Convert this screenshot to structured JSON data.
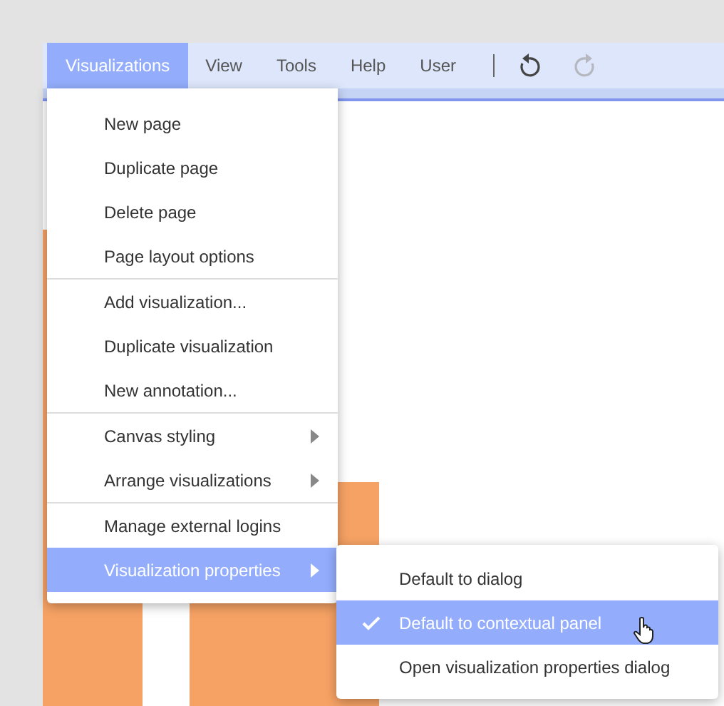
{
  "menu_bar": {
    "items": [
      {
        "label": "Visualizations",
        "selected": true
      },
      {
        "label": "View",
        "selected": false
      },
      {
        "label": "Tools",
        "selected": false
      },
      {
        "label": "Help",
        "selected": false
      },
      {
        "label": "User",
        "selected": false
      }
    ],
    "undo": {
      "disabled": false
    },
    "redo": {
      "disabled": true
    }
  },
  "menu": {
    "sections": [
      [
        {
          "label": "New page",
          "has_submenu": false,
          "selected": false
        },
        {
          "label": "Duplicate page",
          "has_submenu": false,
          "selected": false
        },
        {
          "label": "Delete page",
          "has_submenu": false,
          "selected": false
        },
        {
          "label": "Page layout options",
          "has_submenu": false,
          "selected": false
        }
      ],
      [
        {
          "label": "Add visualization...",
          "has_submenu": false,
          "selected": false
        },
        {
          "label": "Duplicate visualization",
          "has_submenu": false,
          "selected": false
        },
        {
          "label": "New annotation...",
          "has_submenu": false,
          "selected": false
        }
      ],
      [
        {
          "label": "Canvas styling",
          "has_submenu": true,
          "selected": false
        },
        {
          "label": "Arrange visualizations",
          "has_submenu": true,
          "selected": false
        }
      ],
      [
        {
          "label": "Manage external logins",
          "has_submenu": false,
          "selected": false
        },
        {
          "label": "Visualization properties",
          "has_submenu": true,
          "selected": true
        }
      ]
    ]
  },
  "submenu": {
    "items": [
      {
        "label": "Default to dialog",
        "checked": false,
        "selected": false
      },
      {
        "label": "Default to contextual panel",
        "checked": true,
        "selected": true
      },
      {
        "label": "Open visualization properties dialog",
        "checked": false,
        "selected": false
      }
    ]
  }
}
